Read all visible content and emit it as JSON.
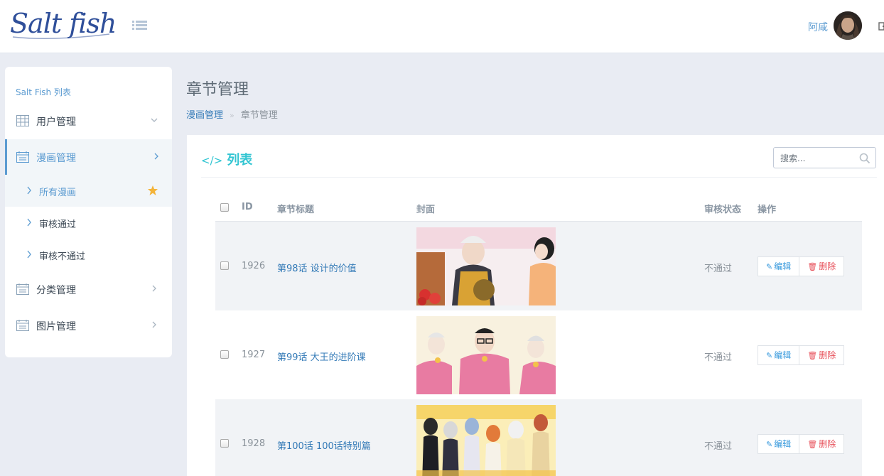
{
  "header": {
    "logo_text": "Salt fish",
    "user_name": "阿咸"
  },
  "sidebar": {
    "heading": "Salt Fish 列表",
    "items": [
      {
        "label": "用户管理",
        "icon": "table-icon",
        "chevron": "chevron-down-icon"
      },
      {
        "label": "漫画管理",
        "icon": "calendar-icon",
        "chevron": "chevron-right-icon",
        "active": true
      },
      {
        "label": "分类管理",
        "icon": "calendar-icon",
        "chevron": "chevron-right-icon"
      },
      {
        "label": "图片管理",
        "icon": "calendar-icon",
        "chevron": "chevron-right-icon"
      }
    ],
    "subitems": [
      {
        "label": "所有漫画",
        "active": true,
        "starred": true
      },
      {
        "label": "审核通过"
      },
      {
        "label": "审核不通过"
      }
    ]
  },
  "page": {
    "title": "章节管理",
    "breadcrumb": {
      "parent": "漫画管理",
      "separator": "»",
      "current": "章节管理"
    }
  },
  "portlet": {
    "code_icon": "</>",
    "title": "列表",
    "search_placeholder": "搜索..."
  },
  "table": {
    "headers": {
      "id": "ID",
      "title": "章节标题",
      "cover": "封面",
      "status": "审核状态",
      "actions": "操作"
    },
    "rows": [
      {
        "id": "1926",
        "title": "第98话 设计的价值",
        "status": "不通过",
        "edit": "编辑",
        "delete": "删除"
      },
      {
        "id": "1927",
        "title": "第99话 大王的进阶课",
        "status": "不通过",
        "edit": "编辑",
        "delete": "删除"
      },
      {
        "id": "1928",
        "title": "第100话 100话特别篇",
        "status": "不通过",
        "edit": "编辑",
        "delete": "删除"
      }
    ]
  },
  "colors": {
    "accent": "#5b9bd1",
    "portlet_title": "#32c5d2",
    "link": "#337ab7",
    "edit": "#3598dc",
    "delete": "#e7505a"
  }
}
